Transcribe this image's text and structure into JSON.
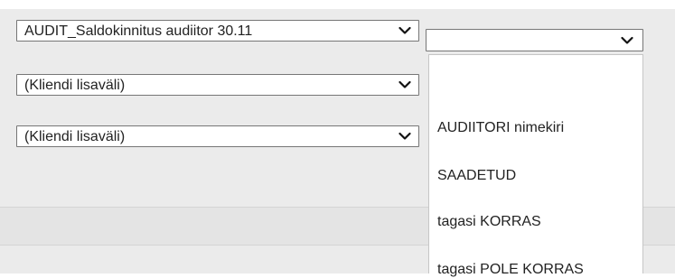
{
  "filters": {
    "report_select_value": "AUDIT_Saldokinnitus audiitor 30.11",
    "client_field_1_value": "(Kliendi lisaväli)",
    "client_field_2_value": "(Kliendi lisaväli)",
    "status_select_value": ""
  },
  "status_dropdown": {
    "options": [
      "",
      "AUDIITORI nimekiri",
      "SAADETUD",
      "tagasi KORRAS",
      "tagasi POLE KORRAS"
    ]
  },
  "icons": {
    "select_arrow": "chevron-down-icon"
  }
}
